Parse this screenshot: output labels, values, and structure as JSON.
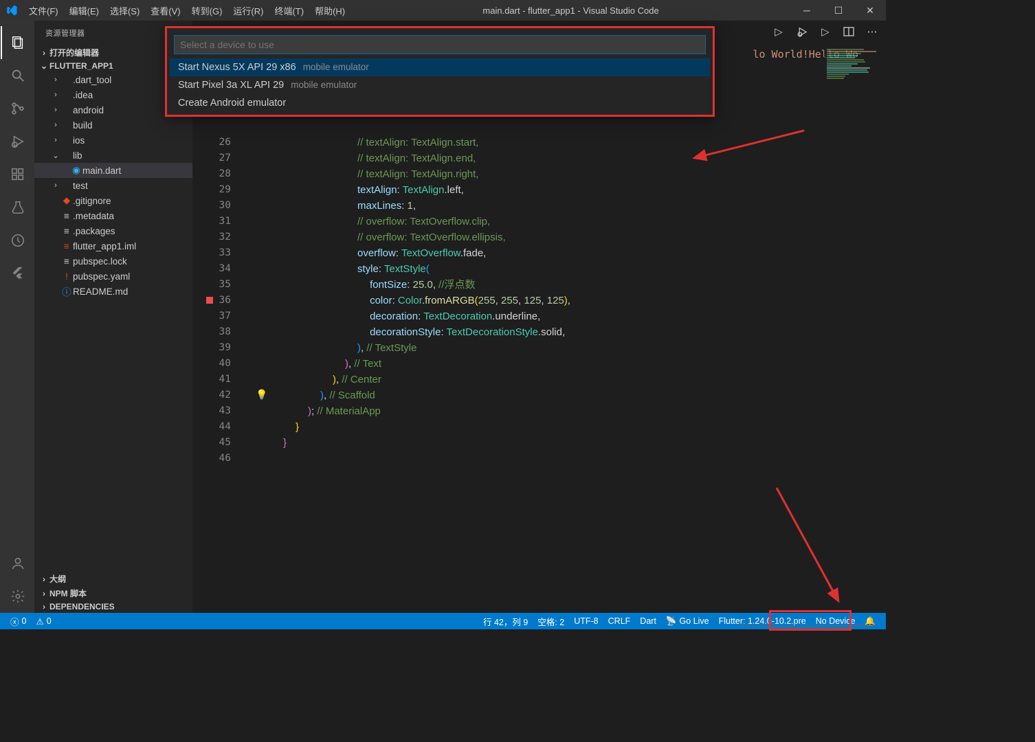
{
  "title": "main.dart - flutter_app1 - Visual Studio Code",
  "menu": [
    "文件(F)",
    "编辑(E)",
    "选择(S)",
    "查看(V)",
    "转到(G)",
    "运行(R)",
    "终端(T)",
    "帮助(H)"
  ],
  "sidebar": {
    "title": "资源管理器",
    "open_editors": "打开的编辑器",
    "project": "FLUTTER_APP1",
    "tree": [
      {
        "kind": "folder",
        "label": ".dart_tool",
        "indent": 1,
        "open": false
      },
      {
        "kind": "folder",
        "label": ".idea",
        "indent": 1,
        "open": false
      },
      {
        "kind": "folder",
        "label": "android",
        "indent": 1,
        "open": false
      },
      {
        "kind": "folder",
        "label": "build",
        "indent": 1,
        "open": false
      },
      {
        "kind": "folder",
        "label": "ios",
        "indent": 1,
        "open": false
      },
      {
        "kind": "folder",
        "label": "lib",
        "indent": 1,
        "open": true
      },
      {
        "kind": "file",
        "label": "main.dart",
        "indent": 2,
        "icon": "dart",
        "selected": true
      },
      {
        "kind": "folder",
        "label": "test",
        "indent": 1,
        "open": false
      },
      {
        "kind": "file",
        "label": ".gitignore",
        "indent": 1,
        "icon": "git"
      },
      {
        "kind": "file",
        "label": ".metadata",
        "indent": 1,
        "icon": "text"
      },
      {
        "kind": "file",
        "label": ".packages",
        "indent": 1,
        "icon": "text"
      },
      {
        "kind": "file",
        "label": "flutter_app1.iml",
        "indent": 1,
        "icon": "yaml"
      },
      {
        "kind": "file",
        "label": "pubspec.lock",
        "indent": 1,
        "icon": "text"
      },
      {
        "kind": "file",
        "label": "pubspec.yaml",
        "indent": 1,
        "icon": "yaml",
        "warn": true
      },
      {
        "kind": "file",
        "label": "README.md",
        "indent": 1,
        "icon": "info"
      }
    ],
    "bottom": [
      "大纲",
      "NPM 脚本",
      "DEPENDENCIES"
    ]
  },
  "quickpick": {
    "placeholder": "Select a device to use",
    "items": [
      {
        "label": "Start Nexus 5X API 29 x86",
        "sub": "mobile emulator",
        "sel": true
      },
      {
        "label": "Start Pixel 3a XL API 29",
        "sub": "mobile emulator",
        "sel": false
      },
      {
        "label": "Create Android emulator",
        "sub": "",
        "sel": false
      }
    ]
  },
  "bread_right_text": "lo World!Hello Wo",
  "code_lines": [
    {
      "n": 26,
      "html": "<span class='c-comment'>// textAlign: TextAlign.start,</span>"
    },
    {
      "n": 27,
      "html": "<span class='c-comment'>// textAlign: TextAlign.end,</span>"
    },
    {
      "n": 28,
      "html": "<span class='c-comment'>// textAlign: TextAlign.right,</span>"
    },
    {
      "n": 29,
      "html": "<span class='c-prop'>textAlign</span><span class='c-punc'>: </span><span class='c-type'>TextAlign</span><span class='c-punc'>.left,</span>"
    },
    {
      "n": 30,
      "html": "<span class='c-prop'>maxLines</span><span class='c-punc'>: </span><span class='c-num'>1</span><span class='c-punc'>,</span>"
    },
    {
      "n": 31,
      "html": "<span class='c-comment'>// overflow: TextOverflow.clip,</span>"
    },
    {
      "n": 32,
      "html": "<span class='c-comment'>// overflow: TextOverflow.ellipsis,</span>"
    },
    {
      "n": 33,
      "html": "<span class='c-prop'>overflow</span><span class='c-punc'>: </span><span class='c-type'>TextOverflow</span><span class='c-punc'>.fade,</span>"
    },
    {
      "n": 34,
      "html": "<span class='c-prop'>style</span><span class='c-punc'>: </span><span class='c-type'>TextStyle</span><span class='c-brace-b'>(</span>"
    },
    {
      "n": 35,
      "html": "  <span class='c-prop'>fontSize</span><span class='c-punc'>: </span><span class='c-num'>25.0</span><span class='c-punc'>, </span><span class='c-comment'>//浮点数</span>"
    },
    {
      "n": 36,
      "html": "  <span class='c-prop'>color</span><span class='c-punc'>: </span><span class='c-type'>Color</span><span class='c-punc'>.</span><span class='c-func'>fromARGB</span><span class='c-brace-y'>(</span><span class='c-num'>255</span><span class='c-punc'>, </span><span class='c-num'>255</span><span class='c-punc'>, </span><span class='c-num'>125</span><span class='c-punc'>, </span><span class='c-num'>125</span><span class='c-brace-y'>)</span><span class='c-punc'>,</span>",
      "err": true
    },
    {
      "n": 37,
      "html": "  <span class='c-prop'>decoration</span><span class='c-punc'>: </span><span class='c-type'>TextDecoration</span><span class='c-punc'>.underline,</span>"
    },
    {
      "n": 38,
      "html": "  <span class='c-prop'>decorationStyle</span><span class='c-punc'>: </span><span class='c-type'>TextDecorationStyle</span><span class='c-punc'>.solid,</span>"
    },
    {
      "n": 39,
      "html": "<span class='c-brace-b'>)</span><span class='c-punc'>, </span><span class='c-comment'>// TextStyle</span>"
    },
    {
      "n": 40,
      "html": "<span class='c-brace-p'>)</span><span class='c-punc'>, </span><span class='c-comment'>// Text</span>",
      "outdent": 1
    },
    {
      "n": 41,
      "html": "<span class='c-brace-y'>)</span><span class='c-punc'>, </span><span class='c-comment'>// Center</span>",
      "outdent": 2
    },
    {
      "n": 42,
      "html": "<span class='c-brace-b'>)</span><span class='c-punc'>, </span><span class='c-comment'>// Scaffold</span>",
      "outdent": 3,
      "bulb": true
    },
    {
      "n": 43,
      "html": "<span class='c-brace-p'>)</span><span class='c-punc'>; </span><span class='c-comment'>// MaterialApp</span>",
      "outdent": 4
    },
    {
      "n": 44,
      "html": "<span class='c-brace-y'>}</span>",
      "outdent": 5
    },
    {
      "n": 45,
      "html": "<span class='c-brace-p'>}</span>",
      "outdent": 6
    },
    {
      "n": 46,
      "html": ""
    }
  ],
  "status": {
    "errors": "0",
    "warnings": "0",
    "right": [
      "行 42，列 9",
      "空格: 2",
      "UTF-8",
      "CRLF",
      "Dart",
      "Go Live",
      "Flutter: 1.24.0-10.2.pre",
      "No Device",
      "🔔"
    ]
  },
  "watermark": "https://blog.csdn.net/Jessieeeeeee"
}
